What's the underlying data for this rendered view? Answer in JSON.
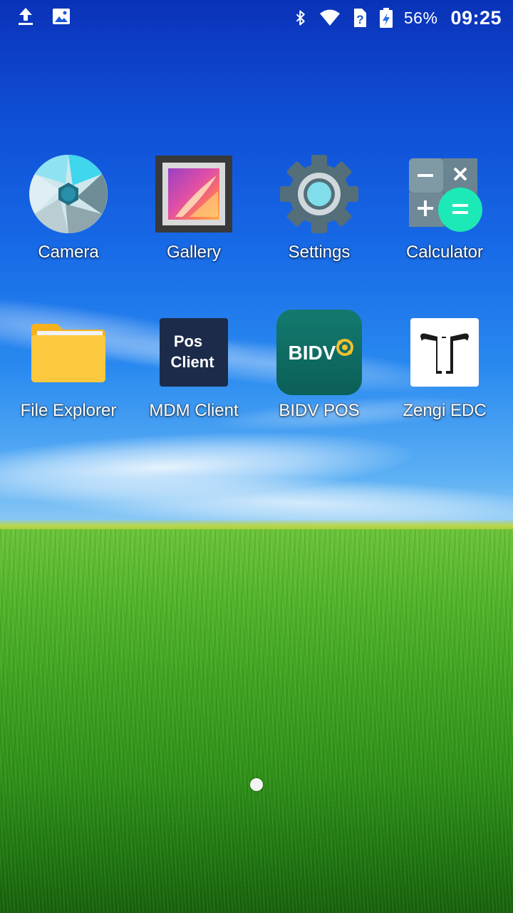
{
  "status_bar": {
    "left_icons": [
      "upload-icon",
      "image-notification-icon"
    ],
    "right_icons": [
      "bluetooth-icon",
      "wifi-icon",
      "no-sim-icon",
      "battery-charging-icon"
    ],
    "battery_percent": "56%",
    "time": "09:25"
  },
  "apps": [
    {
      "label": "Camera",
      "icon": "camera-icon"
    },
    {
      "label": "Gallery",
      "icon": "gallery-icon"
    },
    {
      "label": "Settings",
      "icon": "settings-icon"
    },
    {
      "label": "Calculator",
      "icon": "calculator-icon"
    },
    {
      "label": "File Explorer",
      "icon": "file-explorer-icon"
    },
    {
      "label": "MDM Client",
      "icon": "mdm-client-icon",
      "icon_text": [
        "Pos",
        "Client"
      ]
    },
    {
      "label": "BIDV POS",
      "icon": "bidv-pos-icon",
      "icon_text": "BIDV"
    },
    {
      "label": "Zengi EDC",
      "icon": "zengi-edc-icon"
    }
  ],
  "page_indicator": {
    "current_page": 1,
    "total_pages": 1
  },
  "colors": {
    "calculator_equals": "#1de9b6",
    "bidv_teal": "#0b6b63",
    "mdm_navy": "#1c2b4a",
    "folder_yellow": "#fcc93e"
  }
}
